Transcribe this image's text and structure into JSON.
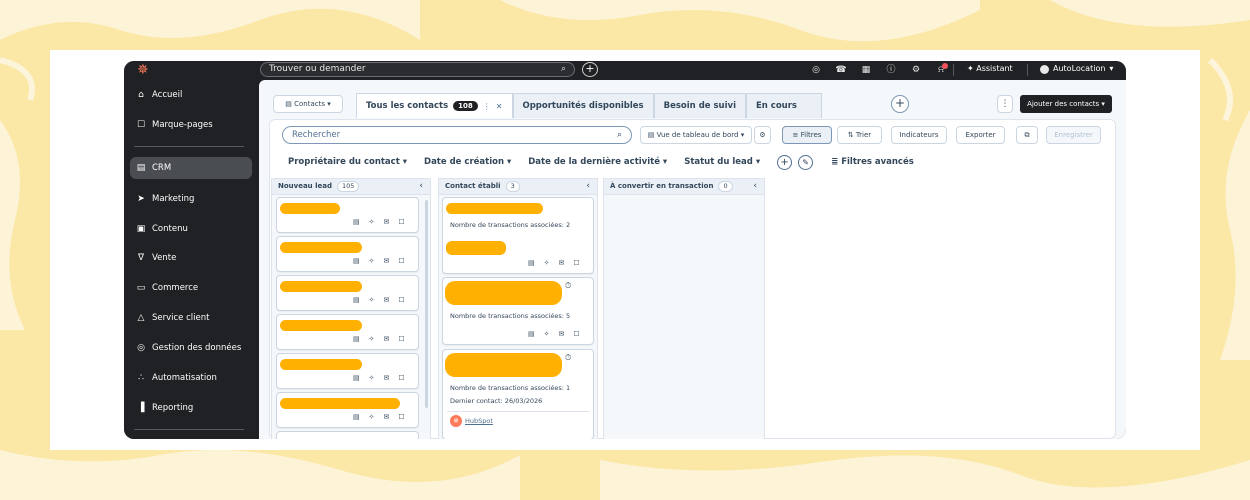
{
  "topbar": {
    "search_placeholder": "Trouver ou demander",
    "assistant_label": "Assistant",
    "account_name": "AutoLocation"
  },
  "sidebar": {
    "items": [
      {
        "label": "Accueil",
        "icon": "home-icon"
      },
      {
        "label": "Marque-pages",
        "icon": "bookmark-icon"
      },
      {
        "label": "CRM",
        "icon": "crm-icon"
      },
      {
        "label": "Marketing",
        "icon": "megaphone-icon"
      },
      {
        "label": "Contenu",
        "icon": "content-icon"
      },
      {
        "label": "Vente",
        "icon": "cart-icon"
      },
      {
        "label": "Commerce",
        "icon": "commerce-icon"
      },
      {
        "label": "Service client",
        "icon": "service-icon"
      },
      {
        "label": "Gestion des données",
        "icon": "database-icon"
      },
      {
        "label": "Automatisation",
        "icon": "automation-icon"
      },
      {
        "label": "Reporting",
        "icon": "chart-icon"
      }
    ],
    "active": "CRM"
  },
  "main": {
    "object_selector": "Contacts",
    "tabs": [
      {
        "label": "Tous les contacts",
        "count": "108"
      },
      {
        "label": "Opportunités disponibles"
      },
      {
        "label": "Besoin de suivi"
      },
      {
        "label": "En cours"
      }
    ],
    "add_contacts_label": "Ajouter des contacts",
    "search_placeholder": "Rechercher",
    "view_selector": "Vue de tableau de bord",
    "filters_label": "Filtres",
    "sort_label": "Trier",
    "indicators_label": "Indicateurs",
    "export_label": "Exporter",
    "save_label": "Enregistrer",
    "filter_dropdowns": [
      "Propriétaire du contact",
      "Date de création",
      "Date de la dernière activité",
      "Statut du lead"
    ],
    "advanced_filters_label": "Filtres avancés"
  },
  "board": {
    "columns": [
      {
        "title": "Nouveau lead",
        "count": "105"
      },
      {
        "title": "Contact établi",
        "count": "3"
      },
      {
        "title": "À convertir en transaction",
        "count": "0"
      }
    ],
    "contact_cards": [
      {
        "text": "Nombre de transactions associées: 2"
      },
      {
        "text": "Nombre de transactions associées: 5"
      },
      {
        "text": "Nombre de transactions associées: 1",
        "text2": "Dernier contact: 26/03/2026",
        "source": "HubSpot"
      }
    ]
  },
  "colors": {
    "background": "#fbe7a6",
    "app_dark": "#1f2124",
    "redaction": "#ffb000",
    "hubspot_orange": "#ff7a59"
  }
}
